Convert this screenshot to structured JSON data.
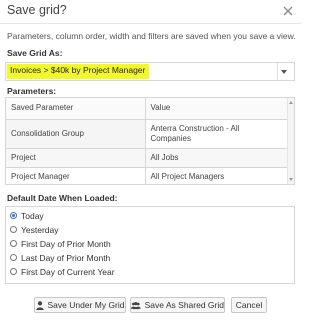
{
  "dialog": {
    "title": "Save grid?",
    "close_icon": "close-icon",
    "note": "Parameters, column order, width and filters are saved when you save a view."
  },
  "save_as": {
    "label": "Save Grid As:",
    "value": "Invoices > $40k by Project Manager",
    "highlight_color": "#f3f82a"
  },
  "parameters": {
    "label": "Parameters:",
    "columns": [
      "Saved Parameter",
      "Value"
    ],
    "rows": [
      {
        "parameter": "Consolidation Group",
        "value": "Anterra Construction - All Companies"
      },
      {
        "parameter": "Project",
        "value": "All Jobs"
      },
      {
        "parameter": "Project Manager",
        "value": "All Project Managers"
      }
    ]
  },
  "default_date": {
    "label": "Default Date When Loaded:",
    "selected": "Today",
    "options": [
      "Today",
      "Yesterday",
      "First Day of Prior Month",
      "Last Day of Prior Month",
      "First Day of Current Year"
    ]
  },
  "buttons": {
    "save_mine": "Save Under My Grid",
    "save_shared": "Save As Shared Grid",
    "cancel": "Cancel",
    "save_mine_icon": "user-icon",
    "save_shared_icon": "users-icon"
  },
  "colors": {
    "accent": "#3b73b9",
    "border": "#d6d6d6"
  }
}
